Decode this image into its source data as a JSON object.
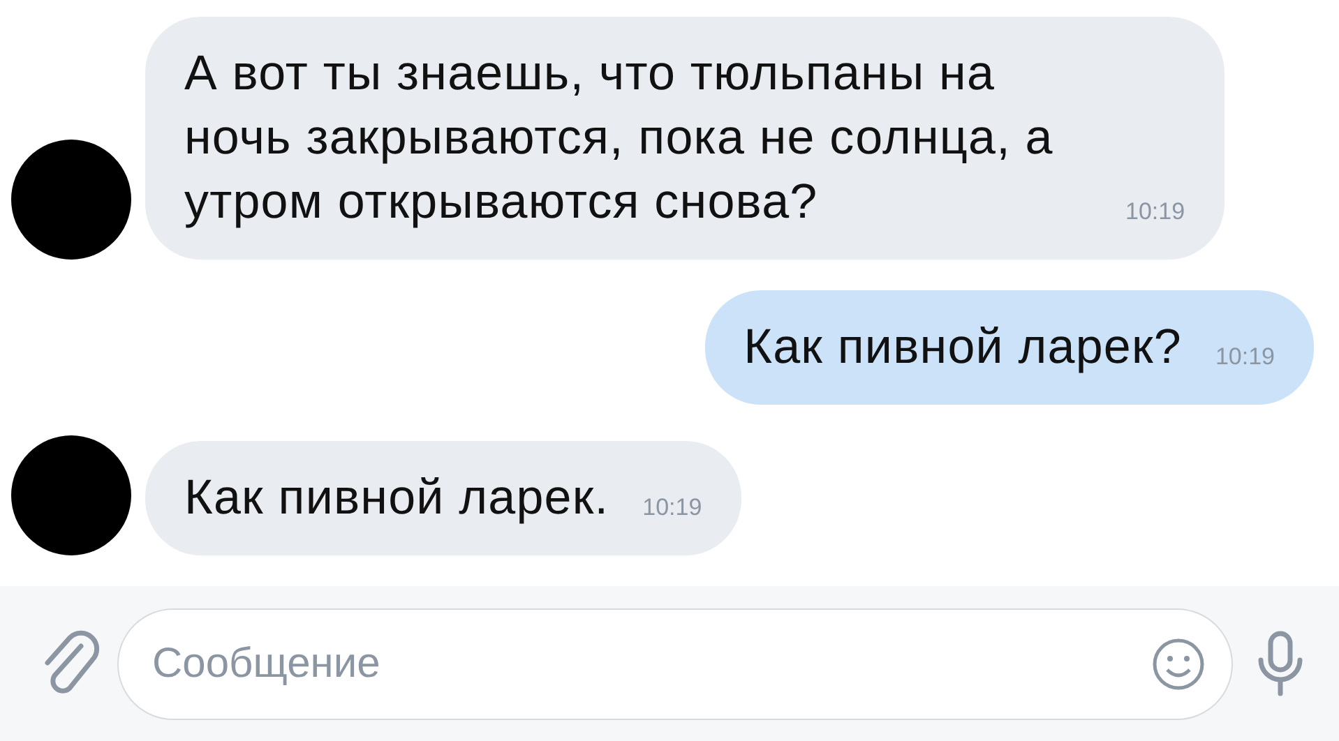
{
  "messages": [
    {
      "kind": "incoming",
      "avatar": true,
      "text": "А вот ты знаешь, что тюльпаны на ночь закрываются, пока не солнца, а утром открываются снова?",
      "time": "10:19"
    },
    {
      "kind": "outgoing",
      "avatar": false,
      "text": "Как пивной ларек?",
      "time": "10:19"
    },
    {
      "kind": "incoming",
      "avatar": true,
      "text": "Как пивной ларек.",
      "time": "10:19"
    }
  ],
  "composer": {
    "placeholder": "Сообщение"
  }
}
